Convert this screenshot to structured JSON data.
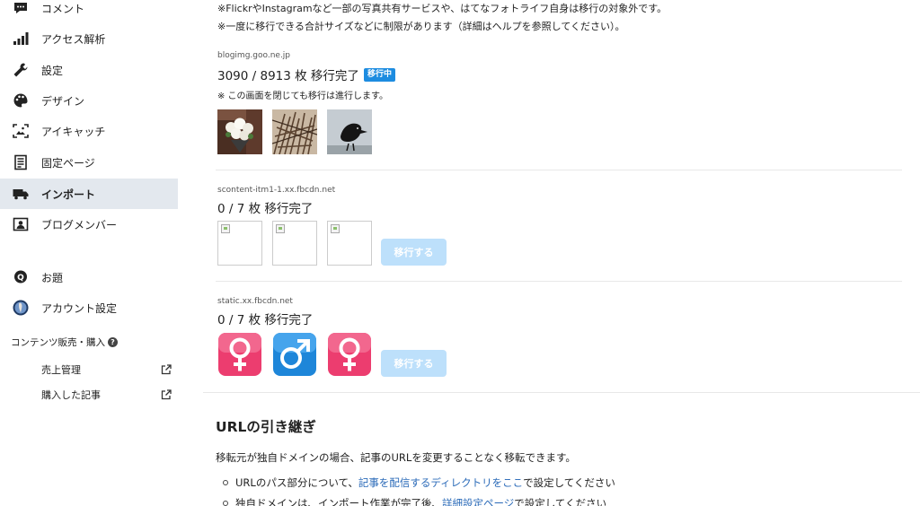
{
  "sidebar": {
    "items": [
      {
        "label": "コメント",
        "icon": "comment-icon"
      },
      {
        "label": "アクセス解析",
        "icon": "signal-bars-icon"
      },
      {
        "label": "設定",
        "icon": "wrench-icon"
      },
      {
        "label": "デザイン",
        "icon": "palette-icon"
      },
      {
        "label": "アイキャッチ",
        "icon": "image-frame-icon"
      },
      {
        "label": "固定ページ",
        "icon": "document-icon"
      },
      {
        "label": "インポート",
        "icon": "truck-icon",
        "active": true
      },
      {
        "label": "ブログメンバー",
        "icon": "member-card-icon"
      },
      {
        "label": "お題",
        "icon": "q-badge-icon"
      },
      {
        "label": "アカウント設定",
        "icon": "avatar-icon"
      }
    ],
    "section_label": "コンテンツ販売・購入",
    "section_help": "?",
    "sub_items": [
      {
        "label": "売上管理",
        "icon": "external-link-icon"
      },
      {
        "label": "購入した記事",
        "icon": "external-link-icon"
      }
    ]
  },
  "main": {
    "notes": [
      "※FlickrやInstagramなど一部の写真共有サービスや、はてなフォトライフ自身は移行の対象外です。",
      "※一度に移行できる合計サイズなどに制限があります（詳細はヘルプを参照してください）。"
    ],
    "blocks": [
      {
        "domain": "blogimg.goo.ne.jp",
        "status": "3090 / 8913 枚 移行完了",
        "badge": "移行中",
        "note": "※ この画面を閉じても移行は進行します。"
      },
      {
        "domain": "scontent-itm1-1.xx.fbcdn.net",
        "status": "0 / 7 枚 移行完了",
        "button": "移行する"
      },
      {
        "domain": "static.xx.fbcdn.net",
        "status": "0 / 7 枚 移行完了",
        "button": "移行する"
      }
    ],
    "url_section": {
      "heading": "URLの引き継ぎ",
      "paragraph": "移転元が独自ドメインの場合、記事のURLを変更することなく移転できます。",
      "bullet1_pre": "URLのパス部分について、",
      "bullet1_link": "記事を配信するディレクトリをここ",
      "bullet1_post": "で設定してください",
      "bullet2_pre": "独自ドメインは、インポート作業が完了後、",
      "bullet2_link": "詳細設定ページ",
      "bullet2_post": "で設定してください"
    }
  },
  "colors": {
    "accent": "#1d8ce0",
    "button_disabled": "#bde0fb",
    "active_nav_bg": "#e3e8ee",
    "link": "#2a6ab8"
  }
}
